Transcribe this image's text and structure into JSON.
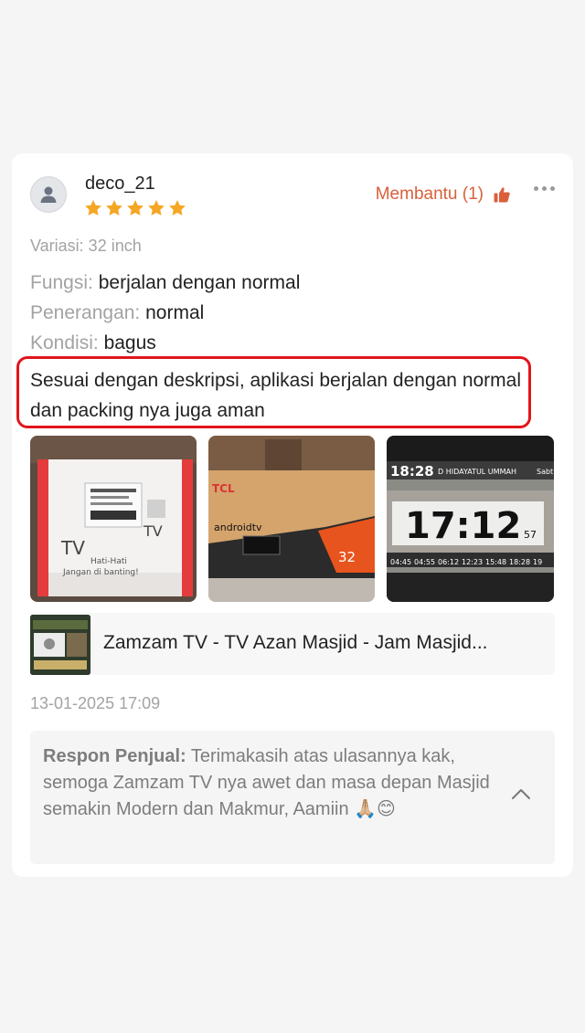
{
  "review": {
    "username": "deco_21",
    "rating": 5,
    "helpful_label": "Membantu (1)",
    "variant": "Variasi: 32 inch",
    "attributes": [
      {
        "key": "Fungsi:",
        "value": "berjalan dengan normal"
      },
      {
        "key": "Penerangan:",
        "value": "normal"
      },
      {
        "key": "Kondisi:",
        "value": "bagus"
      }
    ],
    "text": "Sesuai dengan deskripsi, aplikasi berjalan dengan normal dan packing nya juga aman",
    "date": "13-01-2025 17:09"
  },
  "photos": {
    "photo1": {
      "handwriting": "TV",
      "handwriting2": "Hati-Hati",
      "handwriting3": "Jangan di banting!"
    },
    "photo2": {
      "brand": "TCL",
      "os": "androidtv",
      "size": "32"
    },
    "photo3": {
      "clock_small": "18:28",
      "mosque": "D HIDAYATUL UMMAH",
      "day": "Sabt",
      "clock_big": "17:12",
      "seconds": "57",
      "times": [
        "04:45",
        "04:55",
        "06:12",
        "12:23",
        "15:48",
        "18:28",
        "19"
      ]
    }
  },
  "product": {
    "name": "Zamzam TV - TV Azan Masjid - Jam Masjid..."
  },
  "seller_response": {
    "label": "Respon Penjual:",
    "text": " Terimakasih atas ulasannya kak, semoga Zamzam TV nya awet dan masa depan Masjid semakin Modern dan Makmur, Aamiin 🙏🏼😊"
  },
  "colors": {
    "accent": "#d9603b",
    "star": "#f5a623",
    "highlight_border": "#e2151b"
  },
  "icons": {
    "avatar": "user-icon",
    "helpful": "thumbs-up-icon",
    "more": "more-icon",
    "collapse": "chevron-up-icon"
  }
}
